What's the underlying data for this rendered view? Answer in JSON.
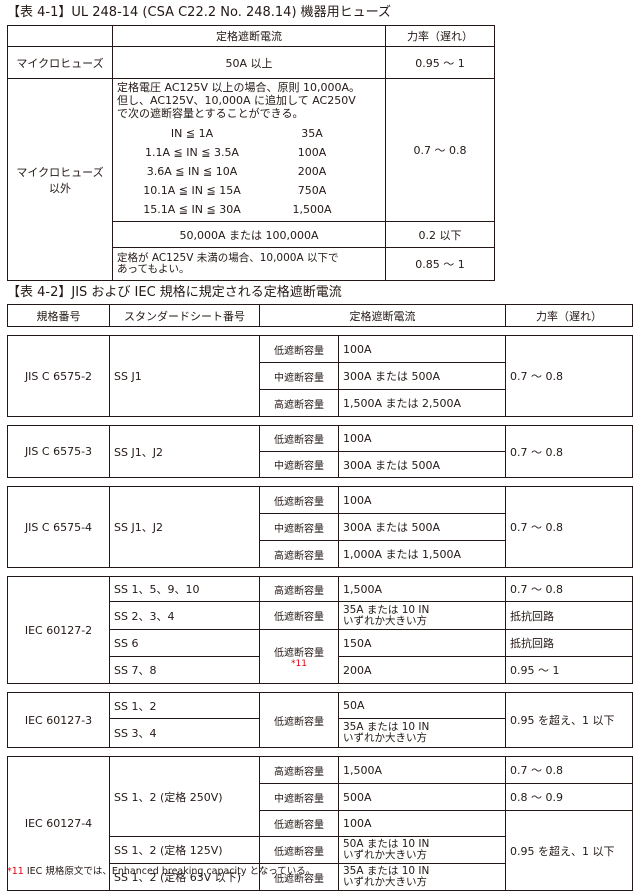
{
  "table1": {
    "caption": "【表 4-1】UL 248-14 (CSA C22.2 No. 248.14) 機器用ヒューズ",
    "headers": [
      "",
      "定格遮断電流",
      "力率（遅れ）"
    ],
    "row_micro": {
      "label": "マイクロヒューズ",
      "current": "50A 以上",
      "pf": "0.95 ～ 1"
    },
    "row_other": {
      "label": "マイクロヒューズ\n以外",
      "text": "定格電圧 AC125V 以上の場合、原則 10,000A。\n但し、AC125V、10,000A に追加して AC250V\nで次の遮断容量とすることができる。",
      "ranges": [
        {
          "range": "IN ≦ 1A",
          "current": "35A"
        },
        {
          "range": "1.1A ≦ IN ≦ 3.5A",
          "current": "100A"
        },
        {
          "range": "3.6A ≦ IN ≦ 10A",
          "current": "200A"
        },
        {
          "range": "10.1A ≦ IN ≦ 15A",
          "current": "750A"
        },
        {
          "range": "15.1A ≦ IN ≦ 30A",
          "current": "1,500A"
        }
      ],
      "pf1": "0.7 ～ 0.8",
      "current2": "50,000A または 100,000A",
      "pf2": "0.2 以下",
      "current3": "定格が AC125V 未満の場合、10,000A 以下で\nあってもよい。",
      "pf3": "0.85 ～ 1"
    }
  },
  "table2": {
    "caption": "【表 4-2】JIS および IEC 規格に規定される定格遮断電流",
    "headers": [
      "規格番号",
      "スタンダードシート番号",
      "定格遮断電流",
      "力率（遅れ）"
    ],
    "labels": {
      "low": "低遮断容量",
      "mid": "中遮断容量",
      "high": "高遮断容量"
    },
    "jis2": {
      "std": "JIS C 6575-2",
      "sheet": "SS J1",
      "v1": "100A",
      "v2": "300A または 500A",
      "v3": "1,500A または 2,500A",
      "pf": "0.7 ～ 0.8"
    },
    "jis3": {
      "std": "JIS C 6575-3",
      "sheet": "SS J1、J2",
      "v1": "100A",
      "v2": "300A または 500A",
      "pf": "0.7 ～ 0.8"
    },
    "jis4": {
      "std": "JIS C 6575-4",
      "sheet": "SS J1、J2",
      "v1": "100A",
      "v2": "300A または 500A",
      "v3": "1,000A または 1,500A",
      "pf": "0.7 ～ 0.8"
    },
    "iec2": {
      "std": "IEC 60127-2",
      "s1": "SS 1、5、9、10",
      "v1": "1,500A",
      "p1": "0.7 ～ 0.8",
      "s2": "SS 2、3、4",
      "v2": "35A または 10 IN\nいずれか大きい方",
      "p2": "抵抗回路",
      "s3": "SS 6",
      "v3": "150A",
      "p3": "抵抗回路",
      "s4": "SS 7、8",
      "v4": "200A",
      "p4": "0.95 ～ 1",
      "fn": "*11"
    },
    "iec3": {
      "std": "IEC 60127-3",
      "s1": "SS 1、2",
      "v1": "50A",
      "s2": "SS 3、4",
      "v2": "35A または 10 IN\nいずれか大きい方",
      "pf": "0.95 を超え、1 以下"
    },
    "iec4": {
      "std": "IEC 60127-4",
      "s1": "SS 1、2 (定格 250V)",
      "v1": "1,500A",
      "p1": "0.7 ～ 0.8",
      "v2": "500A",
      "p2": "0.8 ～ 0.9",
      "v3": "100A",
      "s2": "SS 1、2 (定格 125V)",
      "v4": "50A または 10 IN\nいずれか大きい方",
      "s3": "SS 1、2 (定格 63V 以下)",
      "v5": "35A または 10 IN\nいずれか大きい方",
      "pf": "0.95 を超え、1 以下"
    }
  },
  "footnote": {
    "mark": "*11",
    "text": "IEC 規格原文では、Enhanced breaking capacity となっている。"
  }
}
